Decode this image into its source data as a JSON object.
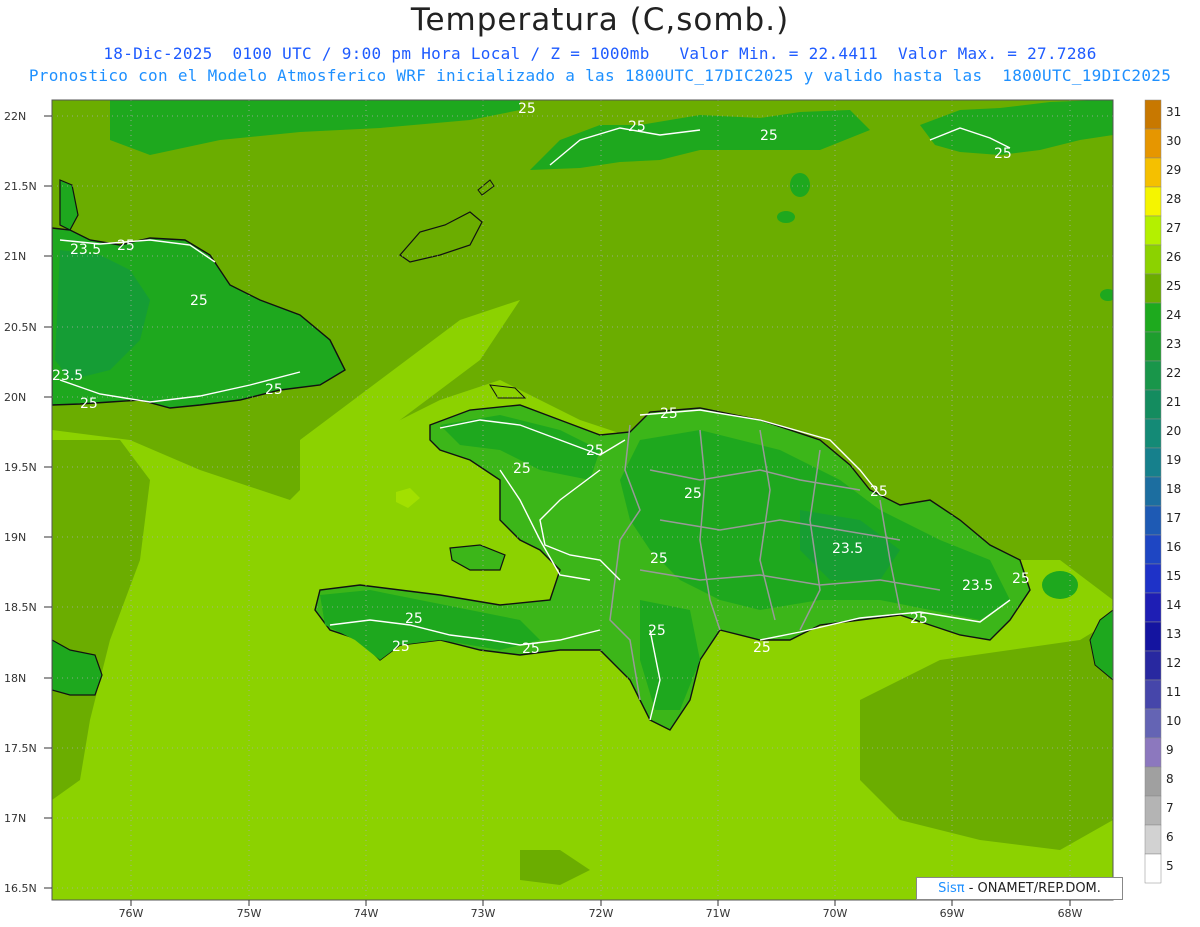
{
  "header": {
    "title": "Temperatura (C,somb.)",
    "line1": "18-Dic-2025  0100 UTC / 9:00 pm Hora Local / Z = 1000mb   Valor Min. = 22.4411  Valor Max. = 27.7286",
    "line2": "Pronostico con el Modelo Atmosferico WRF inicializado a las 1800UTC_17DIC2025 y valido hasta las  1800UTC_19DIC2025"
  },
  "map": {
    "lat_labels": [
      "22N",
      "21.5N",
      "21N",
      "20.5N",
      "20N",
      "19.5N",
      "19N",
      "18.5N",
      "18N",
      "17.5N",
      "17N",
      "16.5N"
    ],
    "lon_labels": [
      "76W",
      "75W",
      "74W",
      "73W",
      "72W",
      "71W",
      "70W",
      "69W",
      "68W"
    ],
    "contour_labels": [
      "25",
      "23.5"
    ],
    "land_labels": {
      "cuba": [
        "23.5",
        "25",
        "25",
        "23.5",
        "25",
        "25"
      ],
      "hispaniola": [
        "25",
        "25",
        "25",
        "25",
        "25",
        "25",
        "25",
        "23.5",
        "23.5",
        "25",
        "25",
        "25",
        "25",
        "25",
        "25"
      ],
      "north": [
        "25",
        "25",
        "25",
        "25"
      ]
    },
    "colors": {
      "sea_24": "#6bad00",
      "sea_25": "#8cd200",
      "sea_26": "#a2e000",
      "land_23": "#1ea81e",
      "land_24": "#3cb619",
      "land_22": "#139a3b"
    }
  },
  "colorbar": {
    "labels": [
      "31",
      "30",
      "29",
      "28",
      "27",
      "26",
      "25",
      "24",
      "23",
      "22",
      "21",
      "20",
      "19",
      "18",
      "17",
      "16",
      "15",
      "14",
      "13",
      "12",
      "11",
      "10",
      "9",
      "8",
      "7",
      "6",
      "5"
    ],
    "colors": [
      "#c87800",
      "#e69600",
      "#f5c000",
      "#f5f500",
      "#b4f000",
      "#8cd200",
      "#6bad00",
      "#1eaa1e",
      "#1e9e2e",
      "#19964a",
      "#148c5f",
      "#148a76",
      "#16808c",
      "#1c6ea0",
      "#1e5ab4",
      "#1e46c3",
      "#1e32c8",
      "#1e1eb4",
      "#1414a0",
      "#2828a0",
      "#4646aa",
      "#6464b4",
      "#8c78be",
      "#a0a0a0",
      "#b4b4b4",
      "#d2d2d2",
      "#ffffff"
    ]
  },
  "credit": {
    "brand": "Sisπ",
    "rest": " - ONAMET/REP.DOM."
  }
}
